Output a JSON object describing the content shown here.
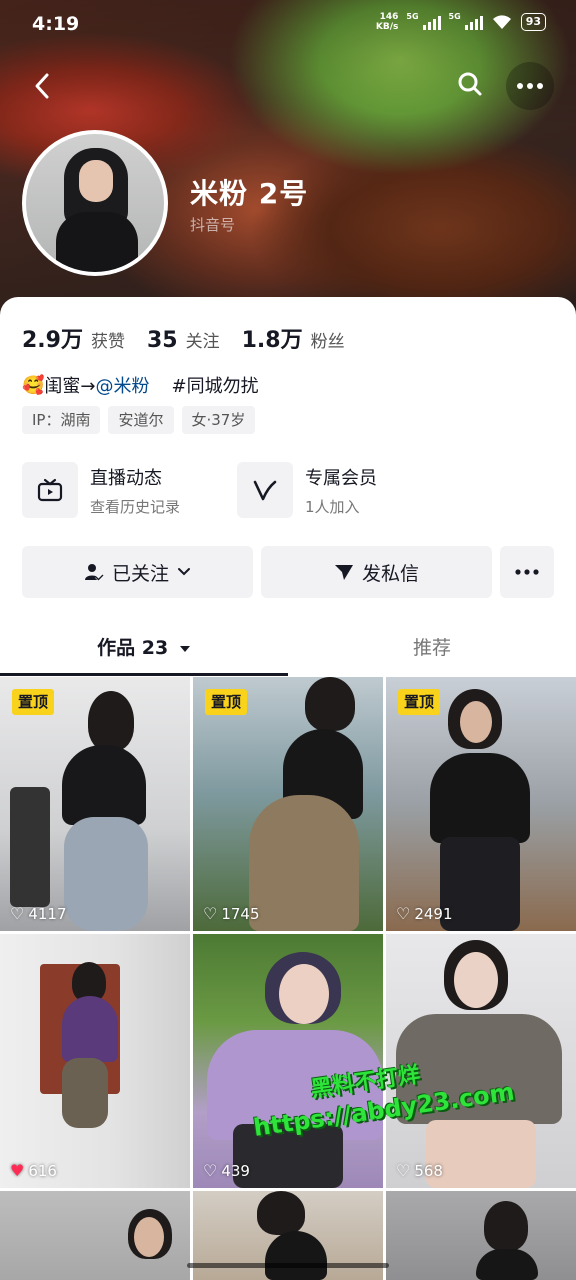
{
  "status_bar": {
    "time": "4:19",
    "net_speed_value": "146",
    "net_speed_unit": "KB/s",
    "sim1": "5G",
    "sim2": "5G",
    "battery": "93"
  },
  "profile": {
    "name": "米粉 2号",
    "douyin_id_label": "抖音号"
  },
  "stats": [
    {
      "value": "2.9万",
      "label": "获赞"
    },
    {
      "value": "35",
      "label": "关注"
    },
    {
      "value": "1.8万",
      "label": "粉丝"
    }
  ],
  "bio": {
    "emoji": "🥰",
    "text": "闺蜜→",
    "mention": "@米粉",
    "hashtag": "#同城勿扰"
  },
  "chips": [
    "IP：湖南",
    "安道尔",
    "女·37岁"
  ],
  "features": [
    {
      "title": "直播动态",
      "subtitle": "查看历史记录",
      "icon": "tv-icon"
    },
    {
      "title": "专属会员",
      "subtitle": "1人加入",
      "icon": "v-badge-icon"
    }
  ],
  "actions": {
    "follow_label": "已关注",
    "message_label": "发私信",
    "more_label": "•••"
  },
  "tabs": {
    "works_label": "作品 23",
    "recommend_label": "推荐"
  },
  "videos": [
    {
      "pinned": true,
      "likes": "4117",
      "liked": false
    },
    {
      "pinned": true,
      "likes": "1745",
      "liked": false
    },
    {
      "pinned": true,
      "likes": "2491",
      "liked": false
    },
    {
      "pinned": false,
      "likes": "616",
      "liked": true
    },
    {
      "pinned": false,
      "likes": "439",
      "liked": false
    },
    {
      "pinned": false,
      "likes": "568",
      "liked": false
    }
  ],
  "pin_label": "置顶",
  "watermark": {
    "line1": "黑料不打烊",
    "line2": "https://abdy23.com"
  },
  "colors": {
    "accent_link": "#04498d",
    "pin_badge": "#f8d21b",
    "like_red": "#fe2c55",
    "watermark_green": "#2ee33a"
  }
}
